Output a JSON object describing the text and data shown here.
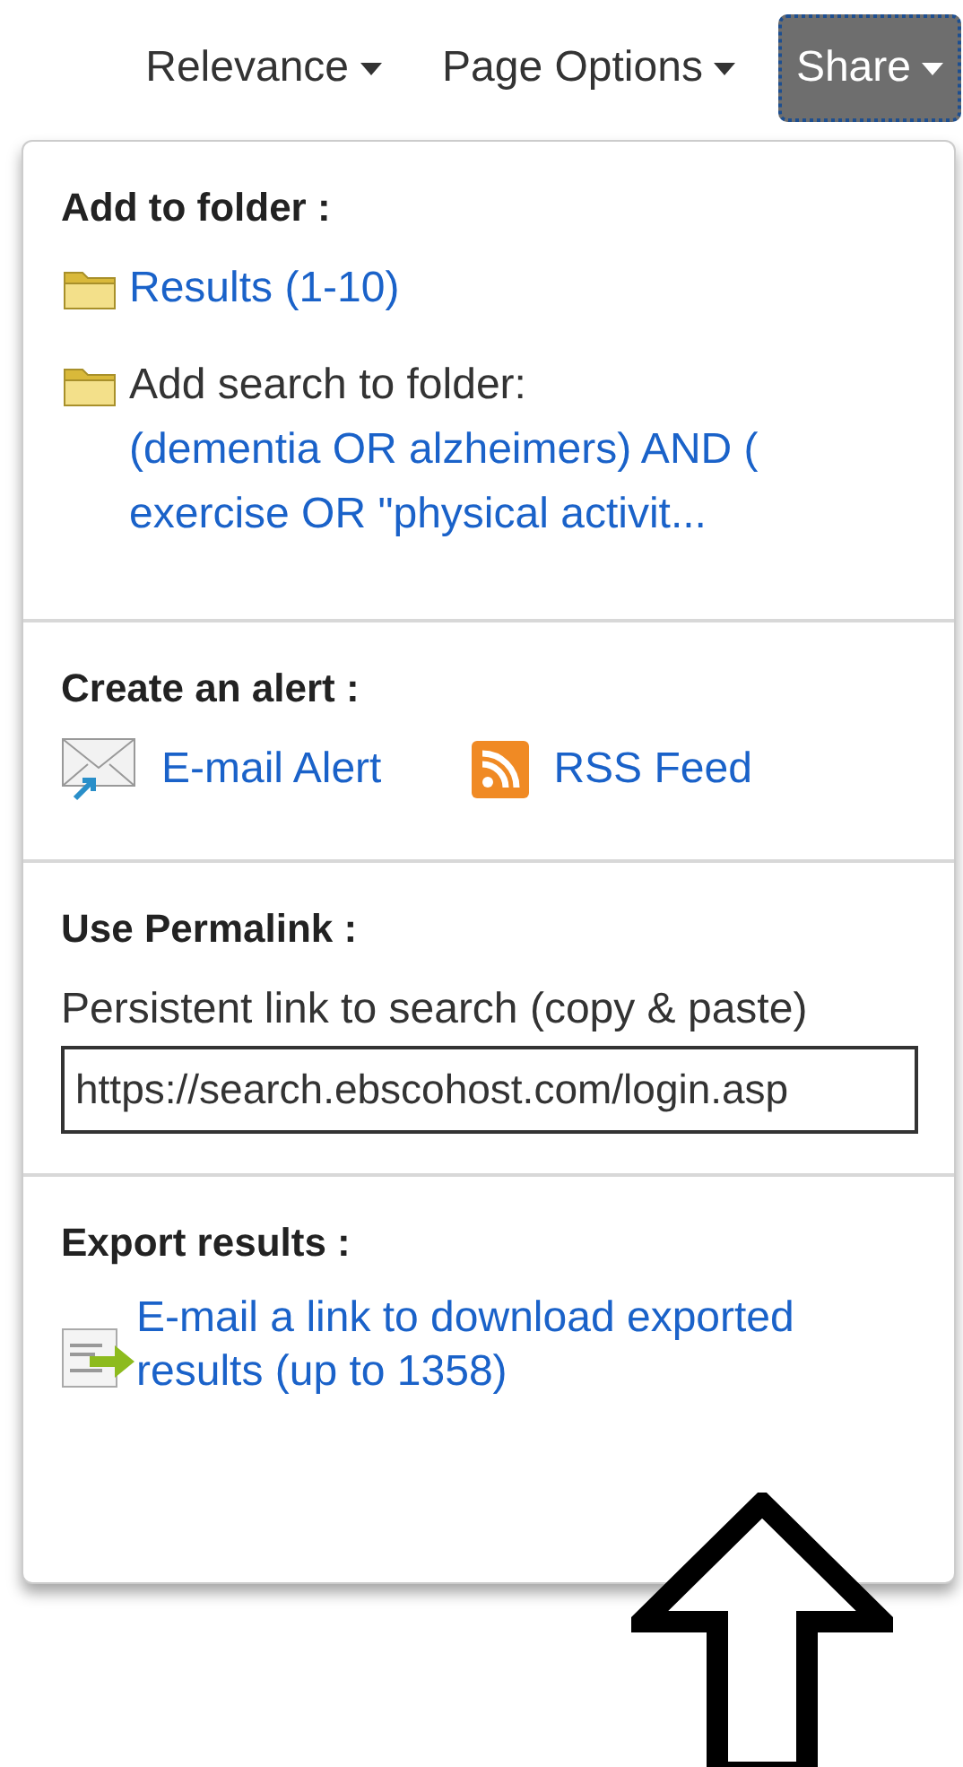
{
  "toolbar": [
    {
      "label": "Relevance",
      "selected": false
    },
    {
      "label": "Page Options",
      "selected": false
    },
    {
      "label": "Share",
      "selected": true
    }
  ],
  "sections": [
    {
      "kind": "folder",
      "heading": "Add to folder :",
      "items": [
        {
          "link": "Results (1-10)"
        },
        {
          "label": "Add search to folder:",
          "link": "(dementia OR alzheimers) AND ( exercise OR \"physical activit..."
        }
      ]
    },
    {
      "kind": "alert",
      "heading": "Create an alert :",
      "items": [
        {
          "kind": "email",
          "link": "E-mail Alert"
        },
        {
          "kind": "feed",
          "link": "RSS Feed"
        }
      ]
    },
    {
      "kind": "permalink",
      "heading": "Use Permalink :",
      "note": "Persistent link to search (copy & paste)",
      "value": "https://search.ebscohost.com/login.asp"
    },
    {
      "kind": "export",
      "heading": "Export results :",
      "link": "E-mail a link to download exported results (up to 1358)"
    }
  ]
}
